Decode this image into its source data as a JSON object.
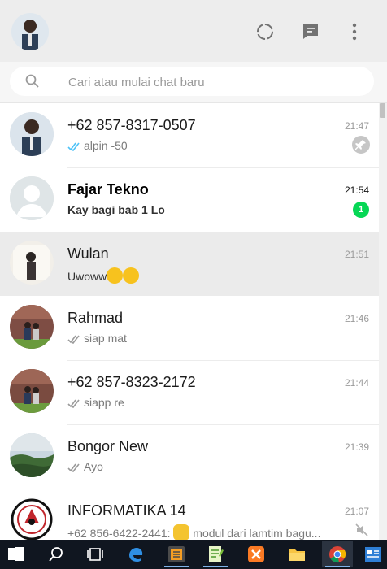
{
  "header": {
    "icons": [
      "status-icon",
      "new-chat-icon",
      "menu-icon"
    ]
  },
  "search": {
    "placeholder": "Cari atau mulai chat baru"
  },
  "chats": [
    {
      "name": "+62 857-8317-0507",
      "time": "21:47",
      "preview": "alpin -50",
      "tick": "double-blue",
      "pinned": true
    },
    {
      "name": "Fajar Tekno",
      "time": "21:54",
      "preview": "Kay bagi bab 1 Lo",
      "unread": 1
    },
    {
      "name": "Wulan",
      "time": "21:51",
      "preview": "Uwoww",
      "emoji": "grinning-sweat-emoji",
      "active": true
    },
    {
      "name": "Rahmad",
      "time": "21:46",
      "preview": "siap mat",
      "tick": "double-gray"
    },
    {
      "name": "+62 857-8323-2172",
      "time": "21:44",
      "preview": "siapp re",
      "tick": "double-gray"
    },
    {
      "name": "Bongor New",
      "time": "21:39",
      "preview": "Ayo",
      "tick": "double-gray"
    },
    {
      "name": "INFORMATIKA 14",
      "time": "21:07",
      "preview_sender": "+62 856-6422-2441:",
      "preview": "modul dari lamtim bagu...",
      "emoji": "clapping-hands-emoji",
      "muted": true
    }
  ],
  "colors": {
    "header_bg": "#ededed",
    "unread_badge": "#06d755",
    "read_tick": "#4fc3f7",
    "active_row": "#ebebeb",
    "taskbar": "#101620"
  },
  "taskbar": {
    "items": [
      "windows-start-icon",
      "search-icon",
      "task-view-icon",
      "edge-icon",
      "sublime-text-icon",
      "notepad-plus-plus-icon",
      "xampp-icon",
      "file-explorer-icon",
      "chrome-icon",
      "app-icon"
    ]
  }
}
